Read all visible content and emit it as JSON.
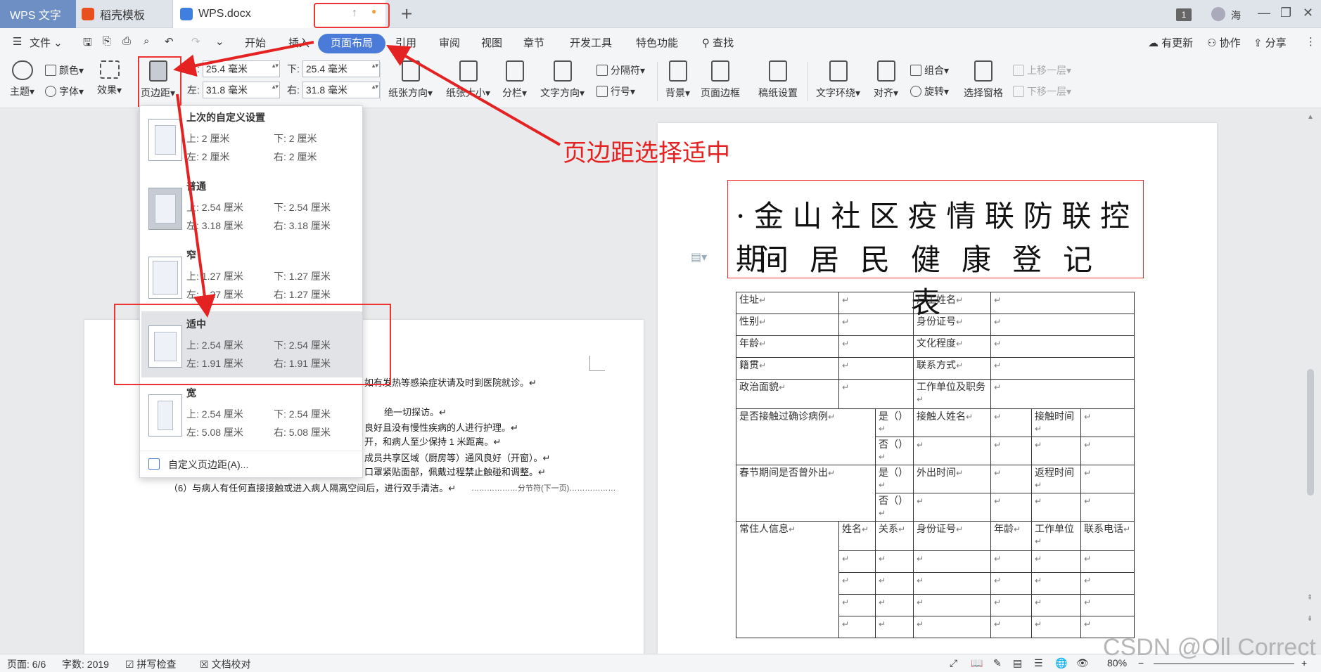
{
  "titlebar": {
    "tabs": [
      "WPS 文字",
      "稻壳模板",
      "WPS.docx"
    ],
    "user": "海",
    "badge": "1"
  },
  "menu": {
    "file": "文件",
    "tabs": [
      "开始",
      "插入",
      "页面布局",
      "引用",
      "审阅",
      "视图",
      "章节",
      "开发工具",
      "特色功能"
    ],
    "search": "查找",
    "right": [
      "有更新",
      "协作",
      "分享"
    ]
  },
  "ribbon": {
    "theme": "主题",
    "color": "颜色",
    "font": "字体",
    "effect": "效果",
    "margins": "页边距",
    "top_label": "上:",
    "top_value": "25.4 毫米",
    "bottom_label": "下:",
    "bottom_value": "25.4 毫米",
    "left_label": "左:",
    "left_value": "31.8 毫米",
    "right_label": "右:",
    "right_value": "31.8 毫米",
    "orientation": "纸张方向",
    "size": "纸张大小",
    "columns": "分栏",
    "text_direction": "文字方向",
    "separator": "分隔符",
    "line_number": "行号",
    "background": "背景",
    "page_border": "页面边框",
    "manuscript": "稿纸设置",
    "text_wrap": "文字环绕",
    "align": "对齐",
    "group": "组合",
    "rotate": "旋转",
    "selection_pane": "选择窗格",
    "bring_forward": "上移一层",
    "send_backward": "下移一层"
  },
  "margin_menu": {
    "items": [
      {
        "name": "上次的自定义设置",
        "top": "上: 2 厘米",
        "bottom": "下: 2 厘米",
        "left": "左: 2 厘米",
        "right": "右: 2 厘米"
      },
      {
        "name": "普通",
        "top": "上: 2.54 厘米",
        "bottom": "下: 2.54 厘米",
        "left": "左: 3.18 厘米",
        "right": "右: 3.18 厘米"
      },
      {
        "name": "窄",
        "top": "上: 1.27 厘米",
        "bottom": "下: 1.27 厘米",
        "left": "左: 1.27 厘米",
        "right": "右: 1.27 厘米"
      },
      {
        "name": "适中",
        "top": "上: 2.54 厘米",
        "bottom": "下: 2.54 厘米",
        "left": "左: 1.91 厘米",
        "right": "右: 1.91 厘米"
      },
      {
        "name": "宽",
        "top": "上: 2.54 厘米",
        "bottom": "下: 2.54 厘米",
        "left": "左: 5.08 厘米",
        "right": "右: 5.08 厘米"
      }
    ],
    "custom": "自定义页边距(A)..."
  },
  "annotation": "页边距选择适中",
  "left_page": {
    "lines": [
      "如有发热等感染症状请及时到医院就诊。↵",
      "绝一切探访。↵",
      "良好且没有慢性疾病的人进行护理。↵",
      "开，和病人至少保持 1 米距离。↵",
      "成员共享区域（厨房等）通风良好（开窗）。↵",
      "口罩紧贴面部，佩戴过程禁止触碰和调整。↵",
      "（6）与病人有任何直接接触或进入病人隔离空间后，进行双手清洁。↵"
    ],
    "section_break": "分节符(下一页)"
  },
  "right_page": {
    "title_line1": "·金山社区疫情联防联控期·",
    "title_line2": "间居民健康登记表",
    "table": {
      "address": "住址",
      "householder": "户主姓名",
      "gender": "性别",
      "id_number": "身份证号",
      "age": "年龄",
      "education": "文化程度",
      "native_place": "籍贯",
      "contact": "联系方式",
      "political": "政治面貌",
      "work_unit": "工作单位及职务",
      "contact_case": "是否接触过确诊病例",
      "yes": "是（）",
      "no": "否（）",
      "contact_name": "接触人姓名",
      "contact_time": "接触时间",
      "spring_out": "春节期间是否曾外出",
      "out_time": "外出时间",
      "return_time": "返程时间",
      "resident_info": "常住人信息",
      "name": "姓名",
      "relation": "关系",
      "id_no": "身份证号",
      "age2": "年龄",
      "unit": "工作单位",
      "phone": "联系电话"
    }
  },
  "statusbar": {
    "page": "页面: 6/6",
    "words": "字数: 2019",
    "spell": "拼写检查",
    "proof": "文档校对",
    "zoom": "80%"
  },
  "watermark": "CSDN @Oll Correct",
  "colors": {
    "accent": "#4a7bd9",
    "annotation": "#e52222"
  }
}
